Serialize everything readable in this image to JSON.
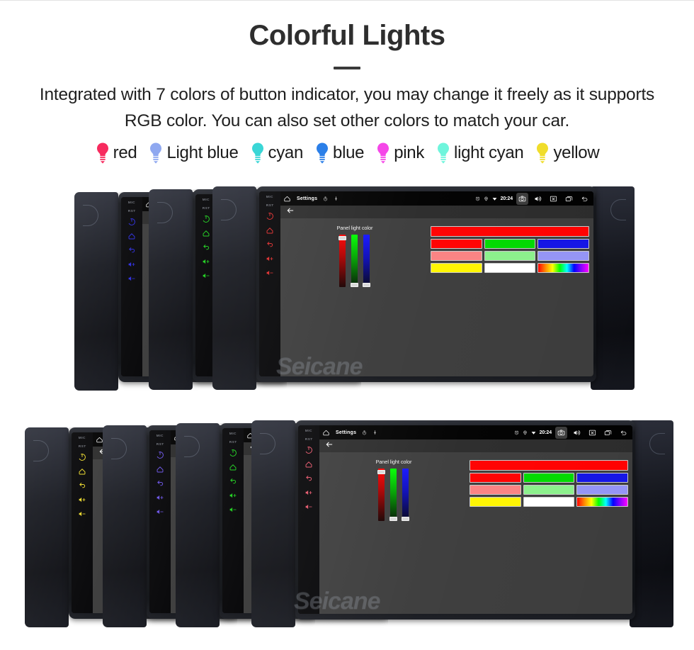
{
  "header": {
    "title": "Colorful Lights",
    "subtitle": "Integrated with 7 colors of button indicator, you may change it freely as it supports RGB color. You can also set other colors to match your car."
  },
  "legend": {
    "items": [
      {
        "label": "red",
        "color": "#F72B5E",
        "icon": "bulb-icon"
      },
      {
        "label": "Light blue",
        "color": "#8FA8F0",
        "icon": "bulb-icon"
      },
      {
        "label": "cyan",
        "color": "#3AD6D6",
        "icon": "bulb-icon"
      },
      {
        "label": "blue",
        "color": "#2B7FE8",
        "icon": "bulb-icon"
      },
      {
        "label": "pink",
        "color": "#F547E8",
        "icon": "bulb-icon"
      },
      {
        "label": "light cyan",
        "color": "#6FF5DC",
        "icon": "bulb-icon"
      },
      {
        "label": "yellow",
        "color": "#F0DD2B",
        "icon": "bulb-icon"
      }
    ]
  },
  "device": {
    "hardware_labels": {
      "mic": "MIC",
      "rst": "RST"
    },
    "hardware_buttons": [
      {
        "name": "power-icon"
      },
      {
        "name": "home-icon"
      },
      {
        "name": "back-icon"
      },
      {
        "name": "volume-up-icon"
      },
      {
        "name": "volume-down-icon"
      }
    ],
    "statusbar": {
      "home_icon": "home-icon",
      "title": "Settings",
      "timer_icon": "timer-icon",
      "usb_icon": "usb-icon",
      "alarm_icon": "alarm-icon",
      "location_icon": "location-icon",
      "wifi_icon": "wifi-icon",
      "clock": "20:24",
      "camera_icon": "camera-icon",
      "volume_icon": "volume-icon",
      "close_icon": "close-box-icon",
      "recents_icon": "recents-icon",
      "back_icon": "back-arrow-icon"
    },
    "appbar": {
      "back_icon": "back-arrow-icon"
    },
    "picker": {
      "caption": "Panel light color",
      "sliders": [
        {
          "channel": "R",
          "color": "#ff0000",
          "thumb_position_pct": 3
        },
        {
          "channel": "G",
          "color": "#00ff00",
          "thumb_position_pct": 92
        },
        {
          "channel": "B",
          "color": "#0000ff",
          "thumb_position_pct": 92
        }
      ],
      "preview_color": "#FF0000",
      "swatches": [
        [
          "#FF0000",
          "#00D900",
          "#1414E6"
        ],
        [
          "#FA8282",
          "#8BF08B",
          "#9494F5"
        ],
        [
          "#FFF500",
          "#FFFFFF",
          "rainbow"
        ]
      ]
    }
  },
  "watermark": {
    "text": "Seicane"
  },
  "groups": {
    "top": {
      "units": [
        {
          "button_color": "#2B2BE0"
        },
        {
          "button_color": "#1DD11D"
        },
        {
          "button_color": "#E02B2B"
        }
      ]
    },
    "bottom": {
      "units": [
        {
          "button_color": "#F0DD2B"
        },
        {
          "button_color": "#6A52E8"
        },
        {
          "button_color": "#1DD11D"
        },
        {
          "button_color": "#E8566B"
        }
      ]
    }
  }
}
